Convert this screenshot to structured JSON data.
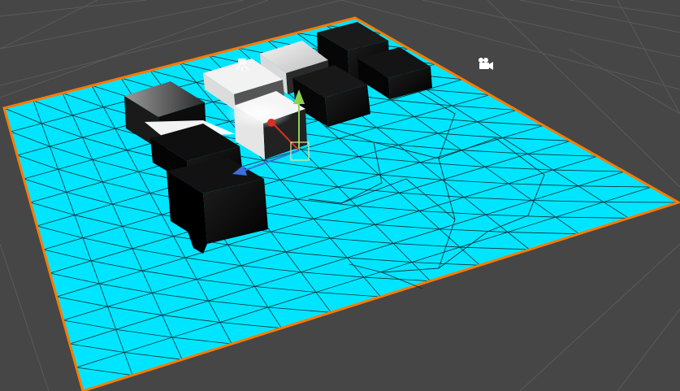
{
  "scene_view": {
    "background_color": "#464646",
    "world_grid_color": "#5a5a5a",
    "floor": {
      "color": "#00e5ff",
      "wireframe_color": "#0b2f36",
      "selection_outline_color": "#ff7a00",
      "selected": true
    },
    "cubes": [
      {
        "name": "back-cube-1",
        "shade": "dark"
      },
      {
        "name": "back-cube-2",
        "shade": "dark"
      },
      {
        "name": "top-cube-lit",
        "shade": "light"
      },
      {
        "name": "left-cube",
        "shade": "mixed"
      },
      {
        "name": "middle-cube",
        "shade": "dark"
      },
      {
        "name": "center-cube-lit",
        "shade": "light"
      },
      {
        "name": "front-left-cube",
        "shade": "dark"
      },
      {
        "name": "bottom-left-cube",
        "shade": "dark"
      }
    ],
    "move_gizmo": {
      "x_axis_color": "#d93025",
      "y_axis_color": "#8fd14f",
      "z_axis_color": "#3a6fe0",
      "plane_handle_color": "#e8e8a0"
    },
    "icons": {
      "light": "light-icon",
      "camera": "camera-icon"
    }
  }
}
